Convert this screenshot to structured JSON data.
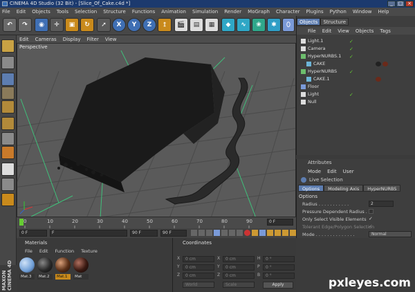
{
  "window": {
    "title": "CINEMA 4D Studio (32 Bit) - [Slice_Of_Cake.c4d *]",
    "controls": [
      "_",
      "□",
      "×"
    ]
  },
  "menubar": [
    "File",
    "Edit",
    "Objects",
    "Tools",
    "Selection",
    "Structure",
    "Functions",
    "Animation",
    "Simulation",
    "Render",
    "MoGraph",
    "Character",
    "Plugins",
    "Python",
    "Window",
    "Help"
  ],
  "toolbar": {
    "axis_buttons": [
      "X",
      "Y",
      "Z"
    ]
  },
  "viewport": {
    "menu": [
      "Edit",
      "Cameras",
      "Display",
      "Filter",
      "View"
    ],
    "label": "Perspective"
  },
  "timeline": {
    "ticks": [
      "0",
      "10",
      "20",
      "30",
      "40",
      "50",
      "60",
      "70",
      "80",
      "90"
    ],
    "end_field": "0 F",
    "start_field": "0 F",
    "field_f": "F",
    "max_field": "90 F",
    "max2_field": "90 F"
  },
  "object_manager": {
    "tabs": [
      "Objects",
      "Structure"
    ],
    "menu": [
      "File",
      "Edit",
      "View",
      "Objects",
      "Tags"
    ],
    "rows": [
      {
        "name": "Light.1",
        "icon_color": "#dddddd"
      },
      {
        "name": "Camera",
        "icon_color": "#dddddd"
      },
      {
        "name": "HyperNURBS.1",
        "icon_color": "#6dbd6d"
      },
      {
        "name": "CAKE",
        "icon_color": "#6db5d8"
      },
      {
        "name": "HyperNURBS",
        "icon_color": "#6dbd6d"
      },
      {
        "name": "CAKE.1",
        "icon_color": "#6db5d8"
      },
      {
        "name": "Floor",
        "icon_color": "#7a9ad8"
      },
      {
        "name": "Light",
        "icon_color": "#dddddd"
      },
      {
        "name": "Null",
        "icon_color": "#dddddd"
      }
    ]
  },
  "attributes": {
    "title": "Attributes",
    "menu": [
      "Mode",
      "Edit",
      "User"
    ],
    "tool_name": "Live Selection",
    "tabs": [
      "Options",
      "Modeling Axis",
      "HyperNURBS"
    ],
    "section": "Options",
    "rows": [
      {
        "label": "Radius . . . . . . . . . . .",
        "value": "2"
      },
      {
        "label": "Pressure Dependent Radius .",
        "value": ""
      },
      {
        "label": "Only Select Visible Elements",
        "value": "✓"
      },
      {
        "label": "Tolerant Edge/Polygon Selection",
        "value": "✓"
      },
      {
        "label": "Mode . . . . . . . . . . . . . .",
        "value": "Normal"
      }
    ]
  },
  "materials": {
    "title": "Materials",
    "menu": [
      "File",
      "Edit",
      "Function",
      "Texture"
    ],
    "items": [
      {
        "label": "Mat.3",
        "color": "#6f9ed6"
      },
      {
        "label": "Mat.2",
        "color": "#2a2a2a"
      },
      {
        "label": "Mat.1",
        "color": "#5a3018"
      },
      {
        "label": "Mat",
        "color": "#3a1a12"
      }
    ]
  },
  "coordinates": {
    "title": "Coordinates",
    "rows": [
      {
        "a": "X",
        "av": "0 cm",
        "b": "X",
        "bv": "0 cm",
        "c": "H",
        "cv": "0 °"
      },
      {
        "a": "Y",
        "av": "0 cm",
        "b": "Y",
        "bv": "0 cm",
        "c": "P",
        "cv": "0 °"
      },
      {
        "a": "Z",
        "av": "0 cm",
        "b": "Z",
        "bv": "0 cm",
        "c": "B",
        "cv": "0 °"
      }
    ],
    "mode_left": "World",
    "mode_mid": "Scale",
    "apply": "Apply"
  },
  "side_brand": "MAXON CINEMA 4D",
  "watermark": "pxleyes.com"
}
